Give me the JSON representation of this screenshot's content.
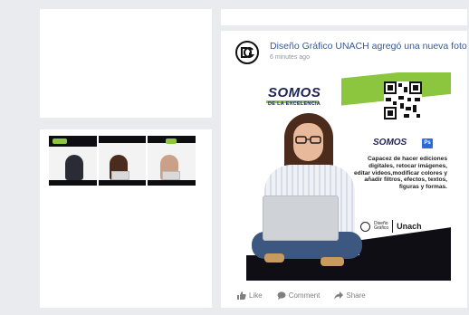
{
  "post": {
    "author_action": "Diseño Gráfico UNACH agregó una nueva foto",
    "timestamp": "6 minutes ago",
    "actions": {
      "like": "Like",
      "comment": "Comment",
      "share": "Share"
    }
  },
  "flyer": {
    "brand_main": "SOMOS",
    "brand_sub": "DE LA EXCELENCIA",
    "somos_label": "SOMOS",
    "ps_badge": "Ps",
    "description": "Capacez de hacer ediciones\ndigitales, retocar imágenes,\neditar videos,modificar colores y\nañadir filtros, efectos, textos,\nfiguras y formas.",
    "logo_text": "Diseño\nGráfico",
    "unach": "Unach"
  },
  "colors": {
    "accent_green": "#8cc63f",
    "brand_navy": "#1f2458",
    "link_blue": "#385898",
    "background": "#e9ebee"
  },
  "icons": [
    "dg-logo-icon",
    "qr-code-icon",
    "like-icon",
    "comment-icon",
    "share-icon"
  ]
}
